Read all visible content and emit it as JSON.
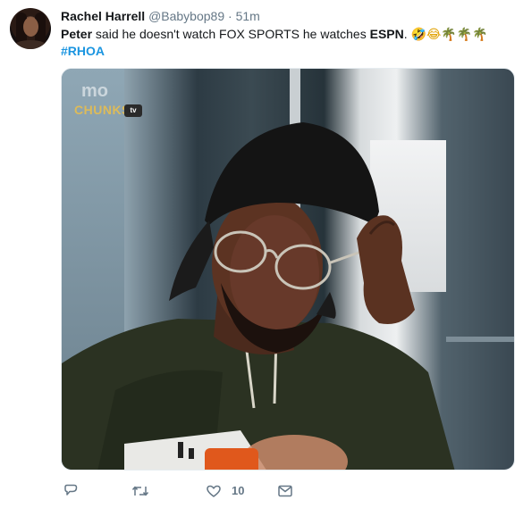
{
  "tweet": {
    "author_name": "Rachel Harrell",
    "handle": "@Babybop89",
    "separator": "·",
    "time": "51m",
    "text_bold_1": "Peter",
    "text_mid": " said he doesn't watch FOX SPORTS he watches ",
    "text_bold_2": "ESPN",
    "text_end": ". ",
    "emoji_laugh_1": "🤣",
    "emoji_laugh_2": "😂",
    "emoji_palm": "🌴",
    "hashtag": "#RHOA"
  },
  "media": {
    "watermark_top": "mo",
    "watermark_bottom": "CHUNKS",
    "watermark_badge": "tv"
  },
  "actions": {
    "reply_icon": "reply-icon",
    "retweet_icon": "retweet-icon",
    "like_icon": "heart-icon",
    "like_count": "10",
    "dm_icon": "envelope-icon"
  },
  "colors": {
    "link": "#1b95e0",
    "muted": "#657786",
    "text": "#14171a"
  }
}
